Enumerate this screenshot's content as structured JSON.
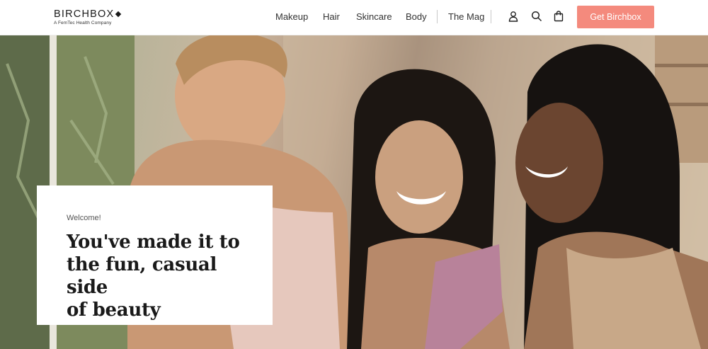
{
  "header": {
    "logo": {
      "wordmark": "BIRCHBOX",
      "tagline": "A FemTec Health Company"
    },
    "nav": [
      {
        "label": "Makeup"
      },
      {
        "label": "Hair"
      },
      {
        "label": "Skincare"
      },
      {
        "label": "Body"
      },
      {
        "label": "The Mag"
      }
    ],
    "icons": [
      "user-icon",
      "search-icon",
      "shopping-bag-icon"
    ],
    "cta_label": "Get Birchbox"
  },
  "hero": {
    "welcome_small": "Welcome!",
    "headline_lines": [
      "You've made it to",
      "the fun, casual side",
      "of beauty"
    ]
  },
  "colors": {
    "accent": "#f48a7d",
    "text": "#1a1a1a"
  }
}
